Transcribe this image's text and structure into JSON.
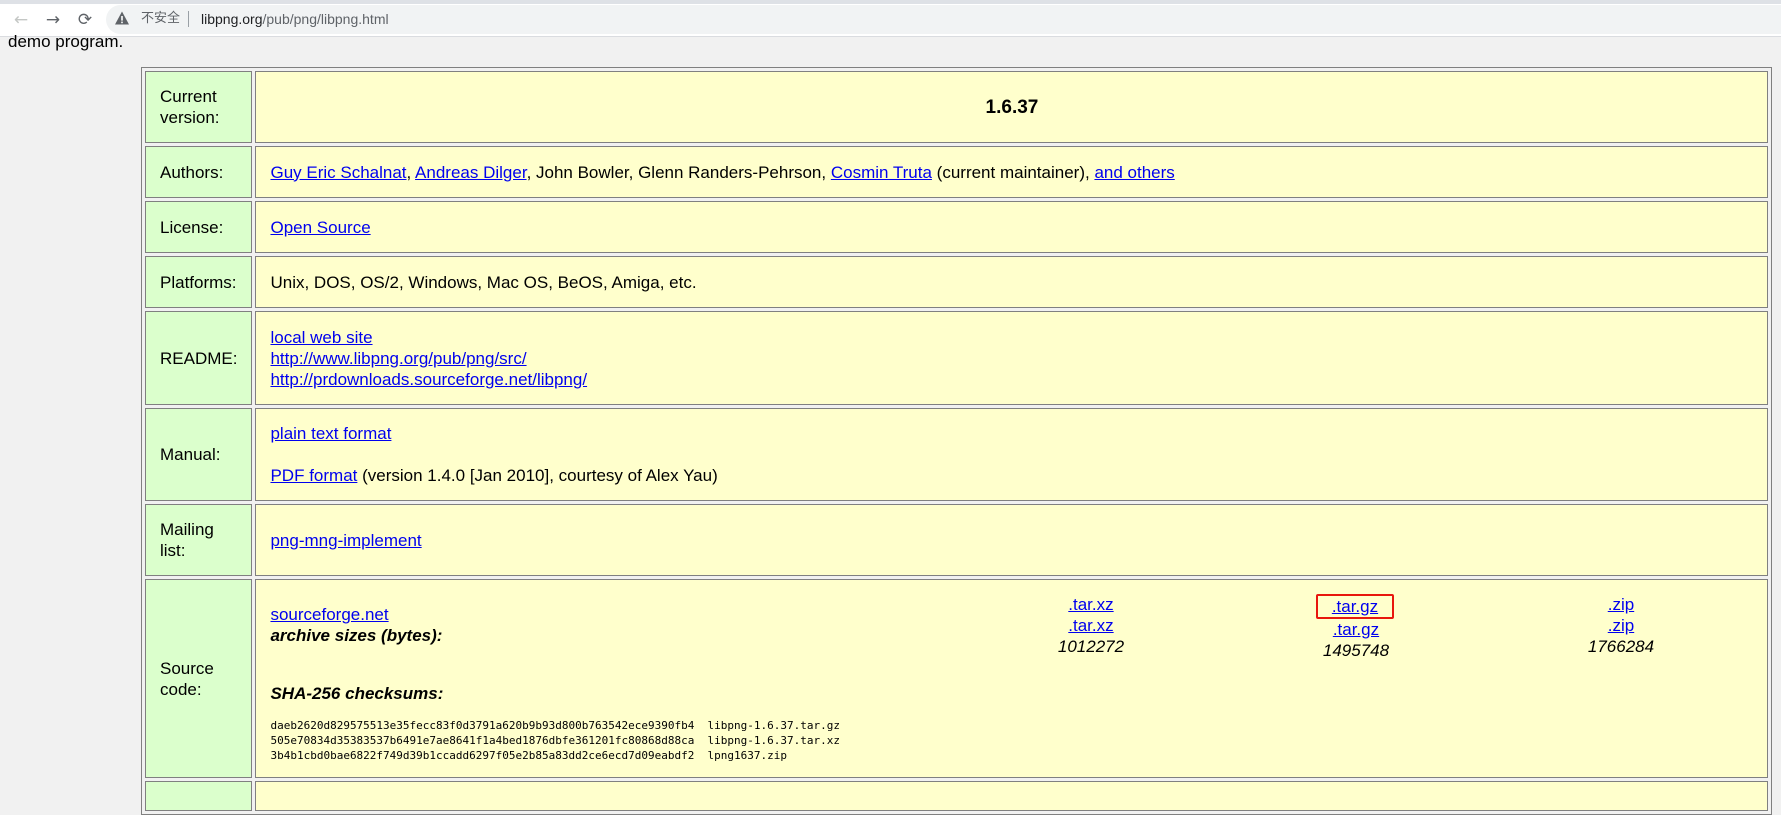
{
  "browser": {
    "security_label": "不安全",
    "url_host": "libpng.org",
    "url_path": "/pub/png/libpng.html"
  },
  "page": {
    "intro_tail": "demo program.",
    "rows": {
      "version": {
        "label": "Current version:",
        "value": "1.6.37"
      },
      "authors": {
        "label": "Authors:",
        "links": [
          "Guy Eric Schalnat",
          "Andreas Dilger"
        ],
        "plain": ", John Bowler, Glenn Randers-Pehrson, ",
        "maintainer_link": "Cosmin Truta",
        "maintainer_note": " (current maintainer), ",
        "others_link": "and others"
      },
      "license": {
        "label": "License:",
        "link": "Open Source"
      },
      "platforms": {
        "label": "Platforms:",
        "value": "Unix, DOS, OS/2, Windows, Mac OS, BeOS, Amiga, etc."
      },
      "readme": {
        "label": "README:",
        "links": [
          "local web site",
          "http://www.libpng.org/pub/png/src/",
          "http://prdownloads.sourceforge.net/libpng/"
        ]
      },
      "manual": {
        "label": "Manual:",
        "text_link": "plain text format",
        "pdf_link": "PDF format",
        "pdf_note": " (version 1.4.0 [Jan 2010], courtesy of Alex Yau)"
      },
      "mailing": {
        "label": "Mailing list:",
        "link": "png-mng-implement"
      },
      "source": {
        "label": "Source code:",
        "site_link": "sourceforge.net",
        "sizes_label": "archive sizes (bytes):",
        "formats": [
          {
            "top": ".tar.xz",
            "mid": ".tar.xz",
            "size": "1012272"
          },
          {
            "top": ".tar.gz",
            "mid": ".tar.gz",
            "size": "1495748"
          },
          {
            "top": ".zip",
            "mid": ".zip",
            "size": "1766284"
          }
        ],
        "sha_label": "SHA-256 checksums:",
        "checksums": [
          "daeb2620d829575513e35fecc83f0d3791a620b9b93d800b763542ece9390fb4  libpng-1.6.37.tar.gz",
          "505e70834d35383537b6491e7ae8641f1a4bed1876dbfe361201fc80868d88ca  libpng-1.6.37.tar.xz",
          "3b4b1cbd0bae6822f749d39b1ccadd6297f05e2b85a83dd2ce6ecd7d09eabdf2  lpng1637.zip"
        ]
      }
    }
  },
  "colors": {
    "label_bg": "#dbffcc",
    "value_bg": "#ffffcc",
    "link": "#0000ee",
    "highlight": "#e8170d"
  }
}
